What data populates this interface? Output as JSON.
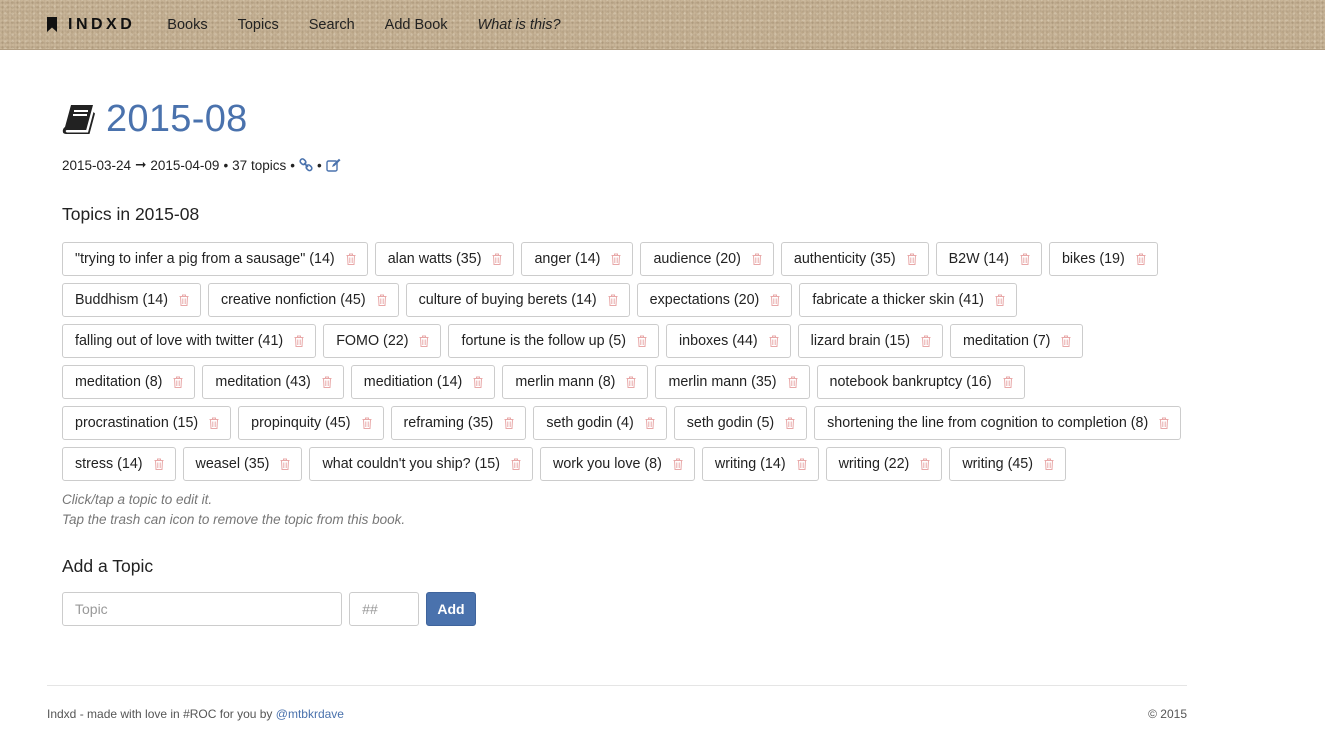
{
  "nav": {
    "brand": "INDXD",
    "links": [
      "Books",
      "Topics",
      "Search",
      "Add Book",
      "What is this?"
    ]
  },
  "book": {
    "title": "2015-08",
    "start_date": "2015-03-24",
    "arrow": "➞",
    "end_date": "2015-04-09",
    "topic_count": "37 topics",
    "bullet": "•"
  },
  "topics_heading": "Topics in 2015-08",
  "topics": [
    "\"trying to infer a pig from a sausage\" (14)",
    "alan watts (35)",
    "anger (14)",
    "audience (20)",
    "authenticity (35)",
    "B2W (14)",
    "bikes (19)",
    "Buddhism (14)",
    "creative nonfiction (45)",
    "culture of buying berets (14)",
    "expectations (20)",
    "fabricate a thicker skin (41)",
    "falling out of love with twitter (41)",
    "FOMO (22)",
    "fortune is the follow up (5)",
    "inboxes (44)",
    "lizard brain (15)",
    "meditation (7)",
    "meditation (8)",
    "meditation (43)",
    "meditiation (14)",
    "merlin mann (8)",
    "merlin mann (35)",
    "notebook bankruptcy (16)",
    "procrastination (15)",
    "propinquity (45)",
    "reframing (35)",
    "seth godin (4)",
    "seth godin (5)",
    "shortening the line from cognition to completion (8)",
    "stress (14)",
    "weasel (35)",
    "what couldn't you ship? (15)",
    "work you love (8)",
    "writing (14)",
    "writing (22)",
    "writing (45)"
  ],
  "help": {
    "line1": "Click/tap a topic to edit it.",
    "line2": "Tap the trash can icon to remove the topic from this book."
  },
  "add_topic": {
    "heading": "Add a Topic",
    "topic_placeholder": "Topic",
    "number_placeholder": "##",
    "button_label": "Add"
  },
  "footer": {
    "left_text": "Indxd - made with love in #ROC for you by ",
    "author_link": "@mtbkrdave",
    "copyright": "© 2015"
  },
  "colors": {
    "accent": "#4a72ad",
    "trash": "#e8a8a8",
    "navbar": "#c8b598"
  },
  "icons": {
    "brand": "bookmark-icon",
    "title": "book-icon",
    "link": "link-icon",
    "edit": "edit-icon",
    "remove": "trash-icon"
  }
}
